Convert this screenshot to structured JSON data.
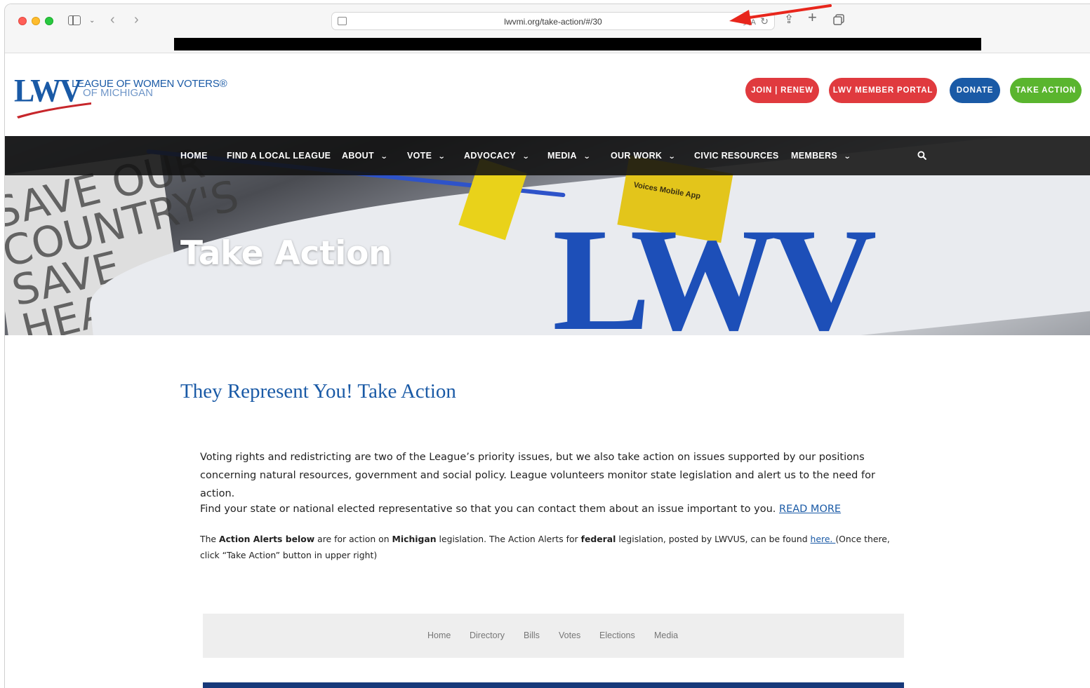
{
  "browser": {
    "url": "lwvmi.org/take-action/#/30"
  },
  "logo": {
    "mark": "LWV",
    "line1": "LEAGUE OF WOMEN VOTERS®",
    "line2": "OF MICHIGAN"
  },
  "header_buttons": {
    "join": "JOIN | RENEW",
    "portal": "LWV MEMBER PORTAL",
    "donate": "DONATE",
    "take_action": "TAKE ACTION"
  },
  "nav": {
    "items": [
      {
        "label": "HOME",
        "has_menu": false
      },
      {
        "label": "FIND A LOCAL LEAGUE",
        "has_menu": false
      },
      {
        "label": "ABOUT",
        "has_menu": true
      },
      {
        "label": "VOTE",
        "has_menu": true
      },
      {
        "label": "ADVOCACY",
        "has_menu": true
      },
      {
        "label": "MEDIA",
        "has_menu": true
      },
      {
        "label": "OUR WORK",
        "has_menu": true
      },
      {
        "label": "CIVIC RESOURCES",
        "has_menu": false
      },
      {
        "label": "MEMBERS",
        "has_menu": true
      }
    ],
    "search_icon": "search-icon"
  },
  "hero": {
    "title": "Take Action",
    "sign_text": "Voices Mobile App"
  },
  "content": {
    "section_title": "They Represent You! Take Action",
    "para1": "Voting rights and redistricting are two of the League’s priority issues, but we also take action on issues supported by our positions concerning natural resources, government and social policy.  League volunteers monitor state legislation and alert us to the need for action.",
    "para2_text": "Find your state or national elected representative so that you can contact them about an issue important to you. ",
    "para2_link": "READ MORE",
    "para3": {
      "t1": "The ",
      "b1": "Action Alerts below",
      "t2": " are for action on ",
      "b2": "Michigan",
      "t3": " legislation.  The Action Alerts for ",
      "b3": "federal",
      "t4": " legislation, posted by LWVUS, can be found ",
      "link": "here. ",
      "t5": "(Once there, click “Take Action” button in upper right)"
    }
  },
  "subnav": {
    "items": [
      "Home",
      "Directory",
      "Bills",
      "Votes",
      "Elections",
      "Media"
    ]
  },
  "colors": {
    "brand_blue": "#1a5aa6",
    "join_red": "#e03a3e",
    "take_action_green": "#5ab52e",
    "nav_bg": "#111111",
    "annotation_arrow": "#e8261c"
  }
}
